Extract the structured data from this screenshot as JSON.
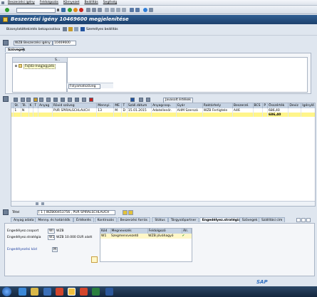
{
  "menu": [
    "Beszerzési igény",
    "Feldolgozás",
    "Környezet",
    "Beállítás",
    "Segítség"
  ],
  "title": "Beszerzési igény 10469600 megjelenítése",
  "app_toolbar": {
    "doc_overview": "Bizonylatáttekintés bekapcsolása",
    "personal_setting": "Személyes beállítás"
  },
  "header_selector": {
    "type": "WZB Beszerzési igény",
    "number": "10469600"
  },
  "texts_tab": "Szövegek",
  "tree": {
    "col_s": "S...",
    "header_note": "Fejléz-megjegyzés"
  },
  "text_format": "Folyamatszöveg",
  "grid": {
    "columns": [
      "St.",
      "Té.",
      "K",
      "T",
      "Anyag",
      "Rövid szöveg",
      "Mennyi.",
      "ME",
      "T",
      "Száll.dátum",
      "Anyagcsop.",
      "Gyár",
      "Raktárhely",
      "Beszerzé.",
      "BCS",
      "P",
      "Összérték",
      "Deviz",
      "Igénylő"
    ],
    "rows": [
      {
        "pos": "1",
        "acct": "N",
        "text": "PUR SPIRALSCHLAUCH",
        "qty": "13",
        "unit": "M",
        "dtype": "D",
        "date": "15.01.2015",
        "matgroup": "Adatellenőr.",
        "plant": "AHM Szerszá",
        "storage": "WZB Fertigtele",
        "pgroup": "A46",
        "value": "686,40"
      }
    ],
    "total": "686,40",
    "sum_button": "Javasolt értékek"
  },
  "item_selector": {
    "label": "Tétel",
    "value": "[ 1 ] WZB00453756 , PUR SPIRALSCHLAUCH"
  },
  "item_tabs": [
    "Anyag adata",
    "Menny. és határidők",
    "Értékelés",
    "Kontírozás",
    "Beszerzési forrás",
    "Státus",
    "Tárgyalópartner",
    "Engedélyez.stratégia",
    "Szövegek",
    "Szállítási cím"
  ],
  "release": {
    "group_label": "Engedélyez.csoport",
    "group_value": "WI",
    "group_desc": "WZB",
    "strategy_label": "Engedélyez.stratégia",
    "strategy_value": "W1",
    "strategy_desc": "WZB 10.000 EUR alatt",
    "indicator_label": "Engedélyezési kód",
    "indicator_value": "M",
    "table_headers": [
      "Kód",
      "Megnevezés",
      "Feldolgozó",
      "Áll."
    ],
    "table_rows": [
      {
        "code": "W1",
        "desc": "Szegmensvezető",
        "processor": "WZB jóváhagyó"
      }
    ]
  },
  "sap_logo": "SAP",
  "colors": {
    "accent": "#1d416d",
    "sum_row": "#fff58a",
    "status_ok": "#2f9e2f"
  }
}
